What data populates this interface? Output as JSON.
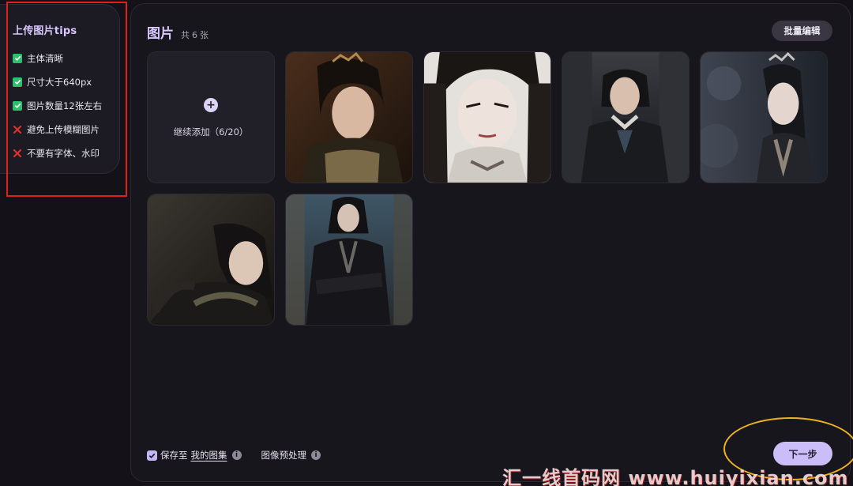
{
  "tips": {
    "title": "上传图片tips",
    "items": [
      {
        "label": "主体清晰",
        "ok": true
      },
      {
        "label": "尺寸大于640px",
        "ok": true
      },
      {
        "label": "图片数量12张左右",
        "ok": true
      },
      {
        "label": "避免上传模糊图片",
        "ok": false
      },
      {
        "label": "不要有字体、水印",
        "ok": false
      }
    ]
  },
  "header": {
    "title": "图片",
    "count_prefix": "共",
    "count": "6",
    "count_suffix": "张",
    "batch_edit": "批量编辑"
  },
  "add_tile": {
    "label": "继续添加（6/20）"
  },
  "bottom": {
    "save_prefix": "保存至",
    "save_target": "我的图集",
    "preprocess": "图像预处理",
    "next": "下一步"
  },
  "watermark": "汇一线首码网 www.huiyixian.com",
  "colors": {
    "accent": "#cbbdf8",
    "ok": "#2fbf6c",
    "bad": "#e0312b"
  }
}
